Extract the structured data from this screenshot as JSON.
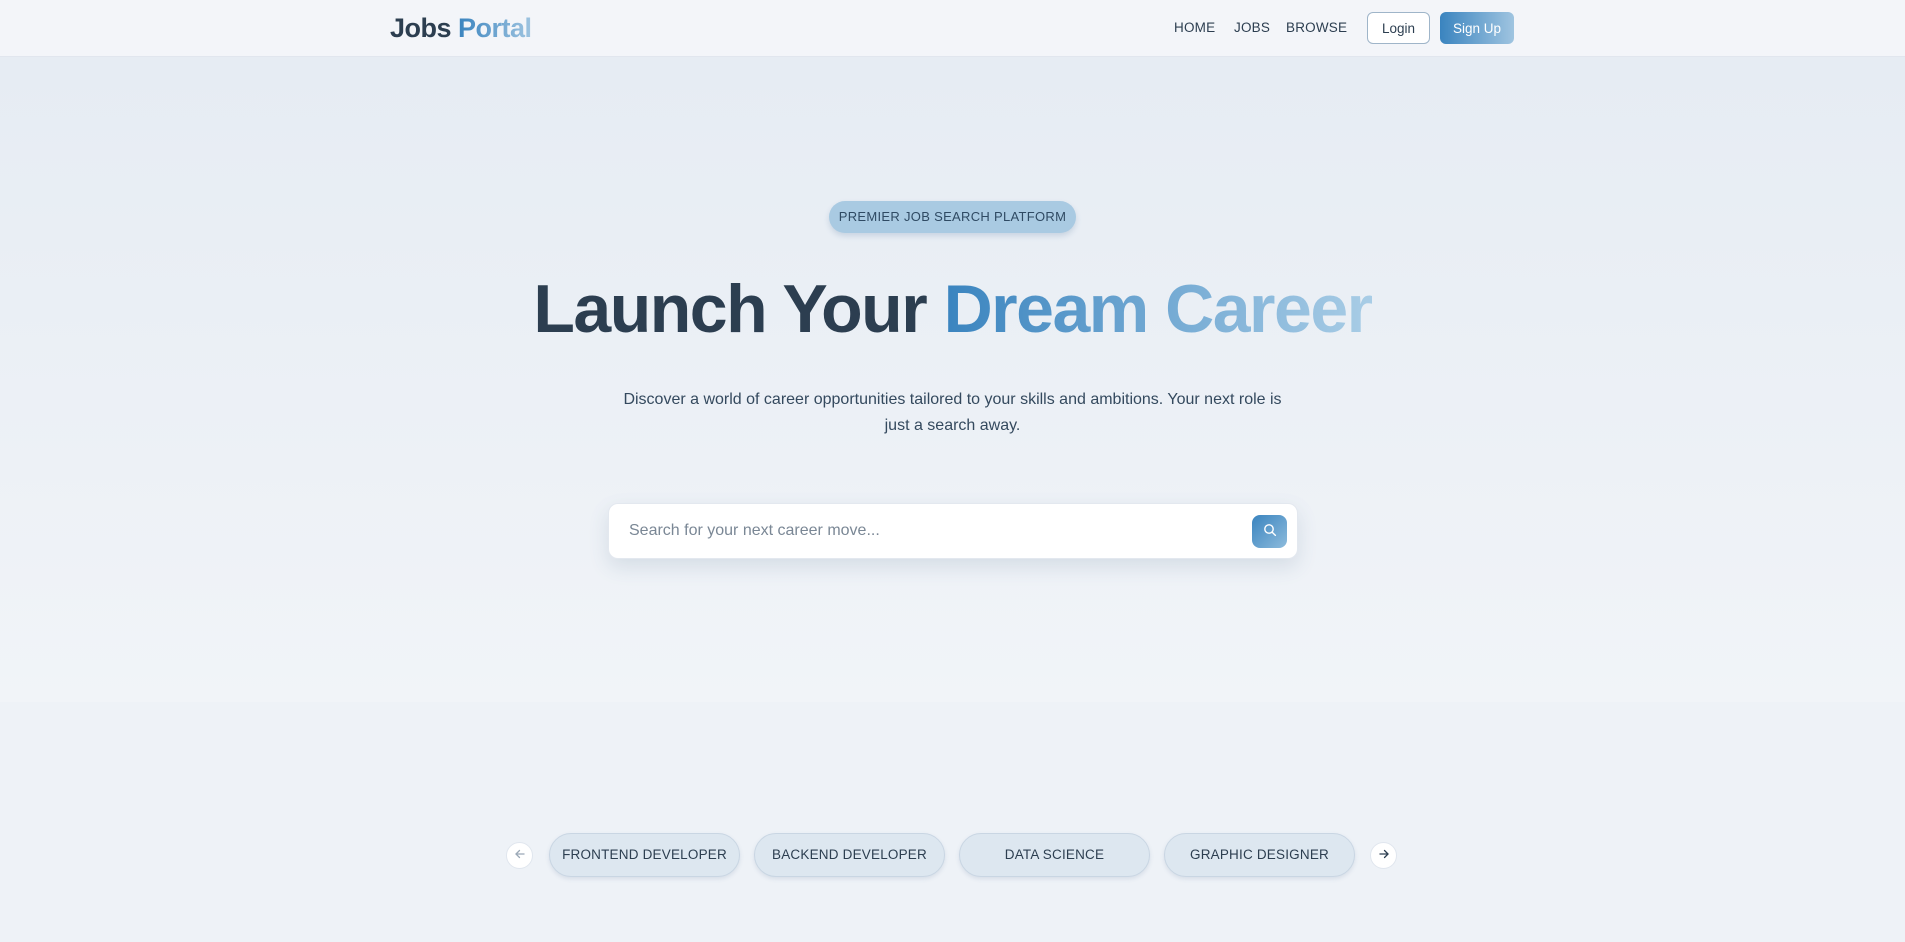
{
  "navbar": {
    "logo_part1": "Jobs ",
    "logo_part2": "Portal",
    "links": [
      "HOME",
      "JOBS",
      "BROWSE"
    ],
    "login_label": "Login",
    "signup_label": "Sign Up"
  },
  "hero": {
    "badge": "PREMIER JOB SEARCH PLATFORM",
    "headline_part1": "Launch Your ",
    "headline_part2": "Dream Career",
    "subtitle": "Discover a world of career opportunities tailored to your skills and ambitions. Your next role is just a search away.",
    "search_placeholder": "Search for your next career move...",
    "search_value": ""
  },
  "categories": {
    "items": [
      "FRONTEND DEVELOPER",
      "BACKEND DEVELOPER",
      "DATA SCIENCE",
      "GRAPHIC DESIGNER"
    ]
  },
  "icons": {
    "search": "search-icon",
    "prev": "arrow-left-icon",
    "next": "arrow-right-icon"
  },
  "colors": {
    "primary_dark": "#2c3e50",
    "accent": "#3a84bf",
    "accent_light": "#9fc4e0",
    "badge_bg": "#a9cae2",
    "chip_bg": "#dde7f0"
  }
}
